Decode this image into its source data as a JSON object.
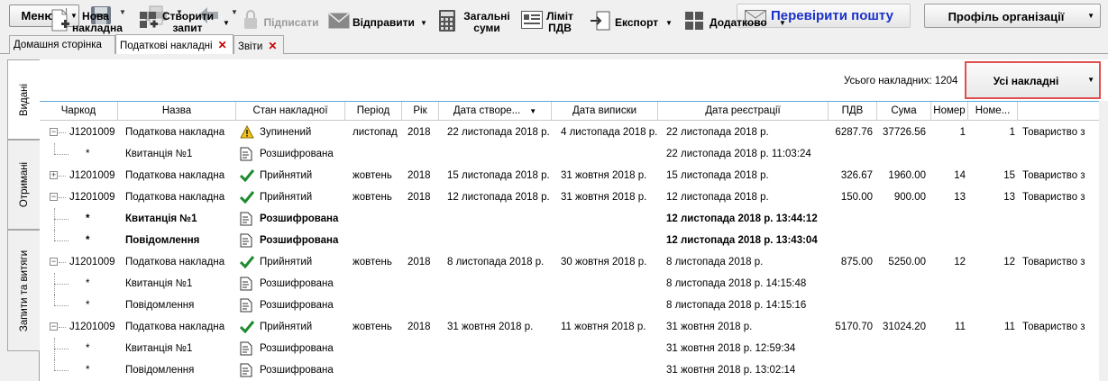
{
  "topbar": {
    "menu_label": "Меню",
    "check_mail_label": "Перевірити пошту",
    "profile_label": "Профіль організації"
  },
  "tabs": [
    {
      "label": "Домашня сторінка",
      "closable": false,
      "active": false
    },
    {
      "label": "Податкові накладні",
      "closable": true,
      "active": true
    },
    {
      "label": "Звіти",
      "closable": true,
      "active": false
    }
  ],
  "side_tabs": [
    "Видані",
    "Отримані",
    "Запити та витяги"
  ],
  "toolbar": {
    "new_invoice": "Нова накладна",
    "create_request": "Створити запит",
    "sign": "Підписати",
    "send": "Відправити",
    "totals": "Загальні суми",
    "vat_limit": "Ліміт ПДВ",
    "export": "Експорт",
    "additional": "Додатково",
    "total_count": "Усього накладних: 1204",
    "filter_label": "Усі накладні"
  },
  "columns": [
    "Чаркод",
    "Назва",
    "Стан накладної",
    "Період",
    "Рік",
    "Дата створе...",
    "Дата виписки",
    "Дата реєстрації",
    "ПДВ",
    "Сума",
    "Номер",
    "Номе...",
    ""
  ],
  "rows": [
    {
      "code": "J1201009",
      "name": "Податкова накладна",
      "status": "Зупинений",
      "status_icon": "warning-icon",
      "period": "листопад",
      "year": "2018",
      "created": "22 листопада 2018 р.",
      "issued": "4 листопада 2018 р.",
      "registered": "22 листопада 2018 р.",
      "vat": "6287.76",
      "sum": "37726.56",
      "num": "1",
      "num2": "1",
      "org": "Товариство з",
      "level": 0,
      "expander": "-",
      "bold": false
    },
    {
      "code": "*",
      "name": "Квитанція №1",
      "status": "Розшифрована",
      "status_icon": "document-icon",
      "period": "",
      "year": "",
      "created": "",
      "issued": "",
      "registered": "22 листопада 2018 р. 11:03:24",
      "vat": "",
      "sum": "",
      "num": "",
      "num2": "",
      "org": "",
      "level": 1,
      "expander": "",
      "bold": false
    },
    {
      "code": "J1201009",
      "name": "Податкова накладна",
      "status": "Прийнятий",
      "status_icon": "check-icon",
      "period": "жовтень",
      "year": "2018",
      "created": "15 листопада 2018 р.",
      "issued": "31 жовтня 2018 р.",
      "registered": "15 листопада 2018 р.",
      "vat": "326.67",
      "sum": "1960.00",
      "num": "14",
      "num2": "15",
      "org": "Товариство з",
      "level": 0,
      "expander": "+",
      "bold": false
    },
    {
      "code": "J1201009",
      "name": "Податкова накладна",
      "status": "Прийнятий",
      "status_icon": "check-icon",
      "period": "жовтень",
      "year": "2018",
      "created": "12 листопада 2018 р.",
      "issued": "31 жовтня 2018 р.",
      "registered": "12 листопада 2018 р.",
      "vat": "150.00",
      "sum": "900.00",
      "num": "13",
      "num2": "13",
      "org": "Товариство з",
      "level": 0,
      "expander": "-",
      "bold": false
    },
    {
      "code": "*",
      "name": "Квитанція №1",
      "status": "Розшифрована",
      "status_icon": "document-icon",
      "period": "",
      "year": "",
      "created": "",
      "issued": "",
      "registered": "12 листопада 2018 р. 13:44:12",
      "vat": "",
      "sum": "",
      "num": "",
      "num2": "",
      "org": "",
      "level": 1,
      "expander": "",
      "bold": true
    },
    {
      "code": "*",
      "name": "Повідомлення",
      "status": "Розшифрована",
      "status_icon": "document-icon",
      "period": "",
      "year": "",
      "created": "",
      "issued": "",
      "registered": "12 листопада 2018 р. 13:43:04",
      "vat": "",
      "sum": "",
      "num": "",
      "num2": "",
      "org": "",
      "level": 1,
      "expander": "",
      "bold": true
    },
    {
      "code": "J1201009",
      "name": "Податкова накладна",
      "status": "Прийнятий",
      "status_icon": "check-icon",
      "period": "жовтень",
      "year": "2018",
      "created": "8 листопада 2018 р.",
      "issued": "30 жовтня 2018 р.",
      "registered": "8 листопада 2018 р.",
      "vat": "875.00",
      "sum": "5250.00",
      "num": "12",
      "num2": "12",
      "org": "Товариство з",
      "level": 0,
      "expander": "-",
      "bold": false
    },
    {
      "code": "*",
      "name": "Квитанція №1",
      "status": "Розшифрована",
      "status_icon": "document-icon",
      "period": "",
      "year": "",
      "created": "",
      "issued": "",
      "registered": "8 листопада 2018 р. 14:15:48",
      "vat": "",
      "sum": "",
      "num": "",
      "num2": "",
      "org": "",
      "level": 1,
      "expander": "",
      "bold": false
    },
    {
      "code": "*",
      "name": "Повідомлення",
      "status": "Розшифрована",
      "status_icon": "document-icon",
      "period": "",
      "year": "",
      "created": "",
      "issued": "",
      "registered": "8 листопада 2018 р. 14:15:16",
      "vat": "",
      "sum": "",
      "num": "",
      "num2": "",
      "org": "",
      "level": 1,
      "expander": "",
      "bold": false
    },
    {
      "code": "J1201009",
      "name": "Податкова накладна",
      "status": "Прийнятий",
      "status_icon": "check-icon",
      "period": "жовтень",
      "year": "2018",
      "created": "31 жовтня 2018 р.",
      "issued": "11 жовтня 2018 р.",
      "registered": "31 жовтня 2018 р.",
      "vat": "5170.70",
      "sum": "31024.20",
      "num": "11",
      "num2": "11",
      "org": "Товариство з",
      "level": 0,
      "expander": "-",
      "bold": false
    },
    {
      "code": "*",
      "name": "Квитанція №1",
      "status": "Розшифрована",
      "status_icon": "document-icon",
      "period": "",
      "year": "",
      "created": "",
      "issued": "",
      "registered": "31 жовтня 2018 р. 12:59:34",
      "vat": "",
      "sum": "",
      "num": "",
      "num2": "",
      "org": "",
      "level": 1,
      "expander": "",
      "bold": false
    },
    {
      "code": "*",
      "name": "Повідомлення",
      "status": "Розшифрована",
      "status_icon": "document-icon",
      "period": "",
      "year": "",
      "created": "",
      "issued": "",
      "registered": "31 жовтня 2018 р. 13:02:14",
      "vat": "",
      "sum": "",
      "num": "",
      "num2": "",
      "org": "",
      "level": 1,
      "expander": "",
      "bold": false
    }
  ],
  "colors": {
    "accent_blue": "#1a31c9",
    "highlight_border": "#e05050",
    "check_green": "#1e8a2e",
    "warning_yellow": "#f3c21a"
  }
}
